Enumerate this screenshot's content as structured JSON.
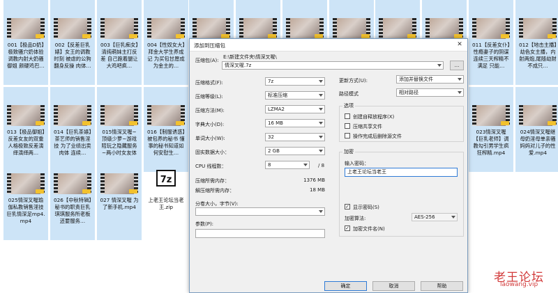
{
  "explorer": {
    "files": [
      {
        "name": "001【极品D奶】极致骚穴奶体验调教内射大奶骚御姐 颜硬鸡巴…",
        "type": "video",
        "selected": true
      },
      {
        "name": "002【反差巨乳婊】女王的调教时刻 被虐的公狗翻身反操 肉体…",
        "type": "video",
        "selected": true
      },
      {
        "name": "003【巨乳痴女】清纯萌妹主打反差 自己跑着腿让大鸡吧疯…",
        "type": "video",
        "selected": true
      },
      {
        "name": "004【性奴女大】拜金大学生养成记 为买包甘愿成为金主的…",
        "type": "video",
        "selected": true
      },
      {
        "name": "",
        "type": "video",
        "selected": true
      },
      {
        "name": "",
        "type": "video",
        "selected": true
      },
      {
        "name": "",
        "type": "video",
        "selected": true
      },
      {
        "name": "",
        "type": "video",
        "selected": true
      },
      {
        "name": "",
        "type": "video",
        "selected": true
      },
      {
        "name": "",
        "type": "video",
        "selected": true
      },
      {
        "name": "011【反差女仆】性瘾妻子的阴谋 连续三天榨精不满足 只能…",
        "type": "video",
        "selected": true
      },
      {
        "name": "012【地击主播】劫色女主播，内射两炮,尾随劫财不成只…",
        "type": "video",
        "selected": true
      },
      {
        "name": "013【极品御姐】反差女友的双重人格极致反差演绎演绎两…",
        "type": "video",
        "selected": true
      },
      {
        "name": "014【巨乳茶婊】茶艺师的销售淫技 为了业绩出卖肉体 连续…",
        "type": "video",
        "selected": true
      },
      {
        "name": "015情深叉喔~顶级少萝~游戏陪玩之隐藏服务~两小时女友体验~精…",
        "type": "video",
        "selected": true
      },
      {
        "name": "016【制服诱惑】被包养的秘书 懂事的秘书知道如何安慰生…",
        "type": "video",
        "selected": true
      },
      {
        "name": "023情深叉喔【巨乳老师】调教勾引男学生疯狂榨精.mp4",
        "type": "video",
        "selected": true
      },
      {
        "name": "024情深叉喔继母奶淫母单亲骚妈妈对儿子的性爱.mp4",
        "type": "video",
        "selected": true
      },
      {
        "name": "025情深叉喔瑜伽私教销售淫技巨乳情深足mp4.mp4",
        "type": "video",
        "selected": true
      },
      {
        "name": "026【中秋特辑】秘书的职责巨乳琪琪服务所老板还要服务…",
        "type": "video",
        "selected": true
      },
      {
        "name": "027 情深叉喔 为了新手机.mp4",
        "type": "video",
        "selected": true
      },
      {
        "name": "上老王论坛当老王.zip",
        "type": "archive",
        "selected": false
      }
    ]
  },
  "dialog": {
    "title": "添加到压缩包",
    "close_label": "✕",
    "archive_label": "压缩包(A):",
    "archive_path": "E:\\新建文件夹\\情深叉喔\\",
    "archive_name": "情深叉喔.7z",
    "browse_label": "...",
    "format_label": "压缩格式(F):",
    "format_value": "7z",
    "level_label": "压缩等级(L):",
    "level_value": "标准压缩",
    "method_label": "压缩方法(M):",
    "method_value": "LZMA2",
    "dict_label": "字典大小(D):",
    "dict_value": "16 MB",
    "word_label": "单词大小(W):",
    "word_value": "32",
    "solid_label": "固实数据大小：",
    "solid_value": "2 GB",
    "cpu_label": "CPU 线程数：",
    "cpu_value": "8",
    "cpu_total": "/ 8",
    "mem_comp_label": "压缩所需内存：",
    "mem_comp_value": "1376 MB",
    "mem_decomp_label": "解压缩所需内存：",
    "mem_decomp_value": "18 MB",
    "split_label": "分卷大小，字节(V):",
    "split_value": "",
    "params_label": "参数(P):",
    "params_value": "",
    "update_label": "更新方式(U):",
    "update_value": "添加并替换文件",
    "path_label": "路径模式",
    "path_value": "相对路径",
    "options_title": "选项",
    "opt_sfx": "创建自释放程序(X)",
    "opt_shared": "压缩共享文件",
    "opt_delete": "操作完成后删除源文件",
    "encrypt_title": "加密",
    "password_label": "输入密码：",
    "password_value": "上老王论坛当老王",
    "show_password": "显示密码(S)",
    "enc_method_label": "加密算法:",
    "enc_method_value": "AES-256",
    "enc_names": "加密文件名(N)",
    "ok_label": "确定",
    "cancel_label": "取消",
    "help_label": "帮助"
  },
  "watermark": {
    "title": "老王论坛",
    "url": "laowang.vip"
  }
}
